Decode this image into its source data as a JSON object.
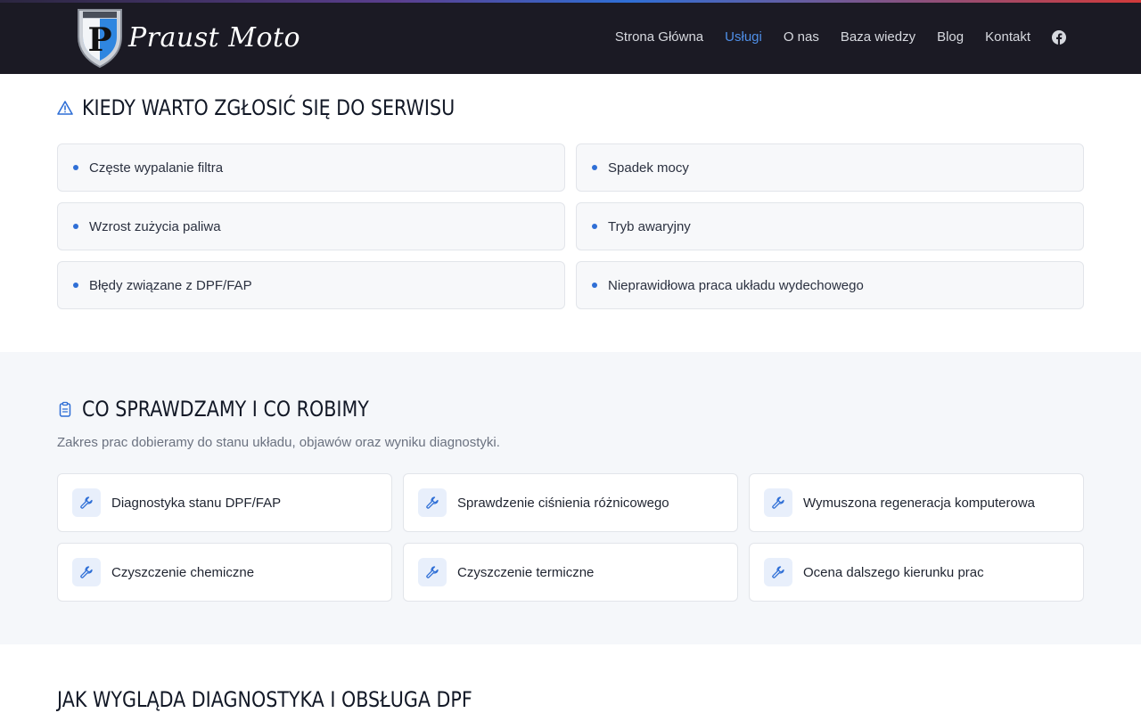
{
  "header": {
    "logo_text": "Praust Moto",
    "logo_mark_letter": "P",
    "nav": [
      {
        "label": "Strona Główna",
        "active": false
      },
      {
        "label": "Usługi",
        "active": true
      },
      {
        "label": "O nas",
        "active": false
      },
      {
        "label": "Baza wiedzy",
        "active": false
      },
      {
        "label": "Blog",
        "active": false
      },
      {
        "label": "Kontakt",
        "active": false
      }
    ],
    "social_icon": "facebook-icon"
  },
  "section_when": {
    "icon": "warning-icon",
    "title": "KIEDY WARTO ZGŁOSIĆ SIĘ DO SERWISU",
    "items": [
      "Częste wypalanie filtra",
      "Spadek mocy",
      "Wzrost zużycia paliwa",
      "Tryb awaryjny",
      "Błędy związane z DPF/FAP",
      "Nieprawidłowa praca układu wydechowego"
    ]
  },
  "section_scope": {
    "icon": "clipboard-icon",
    "title": "CO SPRAWDZAMY I CO ROBIMY",
    "subtitle": "Zakres prac dobieramy do stanu układu, objawów oraz wyniku diagnostyki.",
    "item_icon": "wrench-icon",
    "items": [
      "Diagnostyka stanu DPF/FAP",
      "Sprawdzenie ciśnienia różnicowego",
      "Wymuszona regeneracja komputerowa",
      "Czyszczenie chemiczne",
      "Czyszczenie termiczne",
      "Ocena dalszego kierunku prac"
    ]
  },
  "section_how": {
    "title": "JAK WYGLĄDA DIAGNOSTYKA I OBSŁUGA DPF"
  },
  "colors": {
    "header_bg": "#1b1a24",
    "accent": "#2f6fd6",
    "nav_active": "#4f8fe8",
    "section_alt_bg": "#f5f7fa"
  }
}
